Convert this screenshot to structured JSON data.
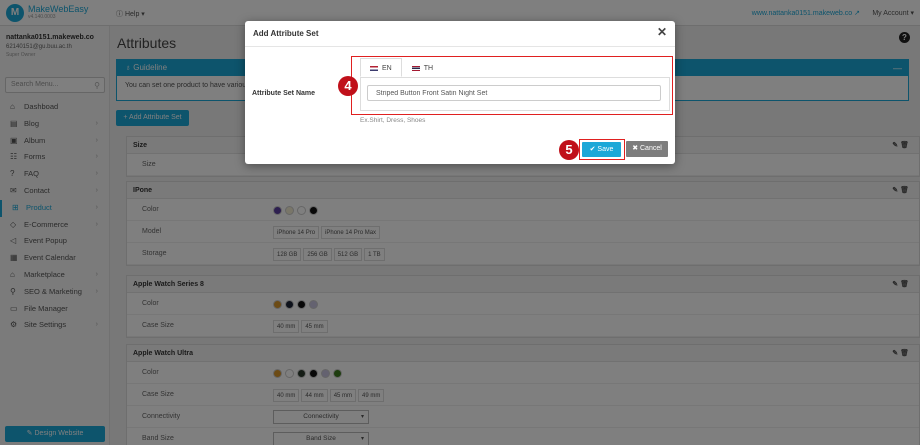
{
  "topbar": {
    "logo_letter": "M",
    "logo_name": "MakeWebEasy",
    "logo_version": "v4.140.0003",
    "help_label": "Help",
    "site_link": "www.nattanka0151.makeweb.co",
    "account_label": "My Account"
  },
  "user": {
    "name": "nattanka0151.makeweb.co",
    "email": "62140151@gu.buu.ac.th",
    "role": "Super Owner"
  },
  "sidebar": {
    "search_placeholder": "Search Menu...",
    "items": [
      {
        "label": "Dashboad",
        "icon": "home-icon",
        "glyph": "⌂",
        "arrow": ""
      },
      {
        "label": "Blog",
        "icon": "document-icon",
        "glyph": "▤",
        "arrow": "›"
      },
      {
        "label": "Album",
        "icon": "image-icon",
        "glyph": "▣",
        "arrow": "›"
      },
      {
        "label": "Forms",
        "icon": "form-icon",
        "glyph": "☷",
        "arrow": "›"
      },
      {
        "label": "FAQ",
        "icon": "question-icon",
        "glyph": "?",
        "arrow": "›"
      },
      {
        "label": "Contact",
        "icon": "mail-icon",
        "glyph": "✉",
        "arrow": "›"
      },
      {
        "label": "Product",
        "icon": "cart-icon",
        "glyph": "⊞",
        "arrow": "›"
      },
      {
        "label": "E-Commerce",
        "icon": "tag-icon",
        "glyph": "◇",
        "arrow": "›"
      },
      {
        "label": "Event Popup",
        "icon": "megaphone-icon",
        "glyph": "◁",
        "arrow": ""
      },
      {
        "label": "Event Calendar",
        "icon": "calendar-icon",
        "glyph": "▦",
        "arrow": ""
      },
      {
        "label": "Marketplace",
        "icon": "shop-icon",
        "glyph": "⌂",
        "arrow": "›"
      },
      {
        "label": "SEO & Marketing",
        "icon": "search-icon",
        "glyph": "⚲",
        "arrow": "›"
      },
      {
        "label": "File Manager",
        "icon": "folder-icon",
        "glyph": "▭",
        "arrow": ""
      },
      {
        "label": "Site Settings",
        "icon": "gear-icon",
        "glyph": "⚙",
        "arrow": "›"
      }
    ],
    "active_index": 6,
    "design_button": "Design Website"
  },
  "main": {
    "title": "Attributes",
    "guideline_title": "Guideline",
    "guideline_text": "You can set one product to have variou",
    "add_button": "+ Add Attribute Set",
    "cards": [
      {
        "title": "Size",
        "rows": [
          {
            "label": "Size",
            "type": "chips",
            "values": []
          }
        ]
      },
      {
        "title": "IPone",
        "rows": [
          {
            "label": "Color",
            "type": "dots",
            "values": [
              "#5b3fa0",
              "#f2ecd2",
              "#ffffff",
              "#111111"
            ]
          },
          {
            "label": "Model",
            "type": "chips",
            "values": [
              "iPhone 14 Pro",
              "iPhone 14 Pro Max"
            ]
          },
          {
            "label": "Storage",
            "type": "chips",
            "values": [
              "128 GB",
              "256 GB",
              "512 GB",
              "1 TB"
            ]
          }
        ]
      },
      {
        "title": "Apple Watch Series 8",
        "rows": [
          {
            "label": "Color",
            "type": "dots",
            "values": [
              "#d8962a",
              "#1d2436",
              "#111111",
              "#c9c4e0"
            ]
          },
          {
            "label": "Case Size",
            "type": "chips",
            "values": [
              "40 mm",
              "45 mm"
            ]
          }
        ]
      },
      {
        "title": "Apple Watch Ultra",
        "rows": [
          {
            "label": "Color",
            "type": "dots",
            "values": [
              "#d8962a",
              "#ffffff",
              "#2b3a2c",
              "#111111",
              "#c9c4e0",
              "#3d7a1e"
            ]
          },
          {
            "label": "Case Size",
            "type": "chips",
            "values": [
              "40 mm",
              "44 mm",
              "45 mm",
              "49 mm"
            ]
          },
          {
            "label": "Connectivity",
            "type": "select",
            "values": [
              "Connectivity"
            ]
          },
          {
            "label": "Band Size",
            "type": "select",
            "values": [
              "Band Size"
            ]
          }
        ]
      }
    ]
  },
  "modal": {
    "title": "Add Attribute Set",
    "close_glyph": "✕",
    "field_label": "Attribute Set Name",
    "tabs": [
      {
        "label": "EN",
        "flag": "en"
      },
      {
        "label": "TH",
        "flag": "th"
      }
    ],
    "input_value": "Striped Button Front Satin Night Set",
    "hint": "Ex.Shirt, Dress, Shoes",
    "save_label": "✔ Save",
    "cancel_label": "✖ Cancel",
    "step4": "4",
    "step5": "5"
  },
  "colors": {
    "accent": "#1ba8d8",
    "annotation": "#e02020"
  }
}
